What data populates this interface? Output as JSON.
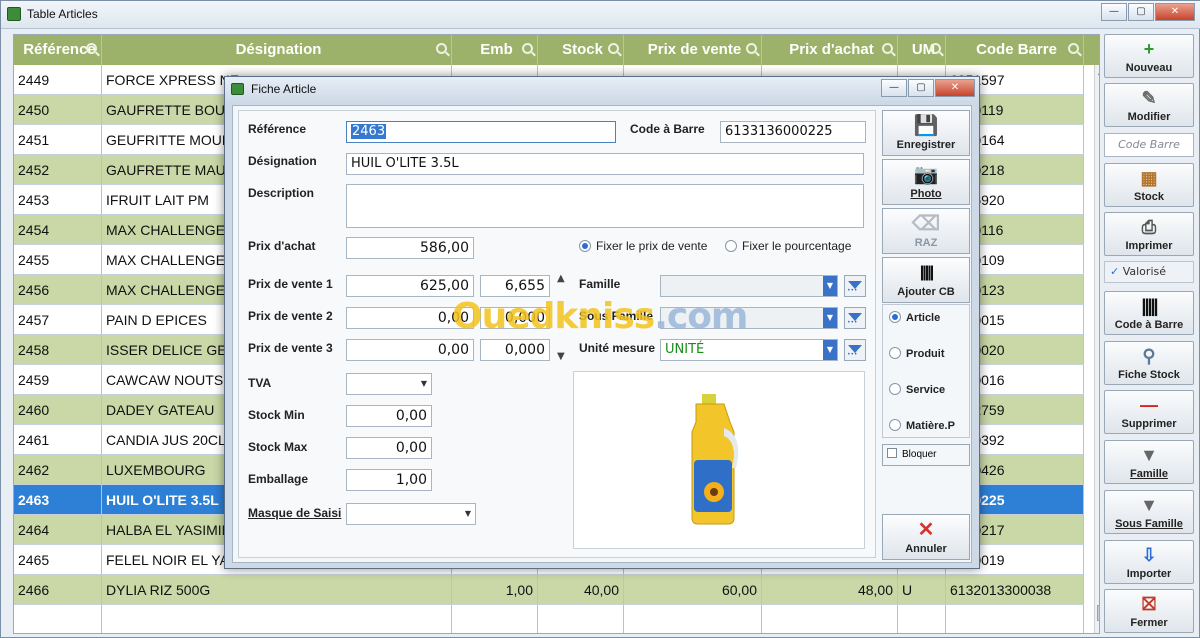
{
  "window": {
    "title": "Table Articles",
    "controls": [
      "—",
      "▢",
      "✕"
    ]
  },
  "grid": {
    "columns": [
      {
        "key": "ref",
        "label": "Référence"
      },
      {
        "key": "des",
        "label": "Désignation"
      },
      {
        "key": "emb",
        "label": "Emb"
      },
      {
        "key": "stock",
        "label": "Stock"
      },
      {
        "key": "pv",
        "label": "Prix de vente"
      },
      {
        "key": "pa",
        "label": "Prix d'achat"
      },
      {
        "key": "um",
        "label": "UM"
      },
      {
        "key": "cb",
        "label": "Code Barre"
      }
    ],
    "rows": [
      {
        "ref": "2449",
        "des": "FORCE XPRESS NE",
        "emb": "",
        "stock": "",
        "pv": "",
        "pa": "",
        "um": "",
        "cb": "6051597"
      },
      {
        "ref": "2450",
        "des": "GAUFRETTE BOUL",
        "emb": "",
        "stock": "",
        "pv": "",
        "pa": "",
        "um": "",
        "cb": "1000119"
      },
      {
        "ref": "2451",
        "des": "GEUFRITTE MOUM",
        "emb": "",
        "stock": "",
        "pv": "",
        "pa": "",
        "um": "",
        "cb": "1000164"
      },
      {
        "ref": "2452",
        "des": "GAUFRETTE MAUM",
        "emb": "",
        "stock": "",
        "pv": "",
        "pa": "",
        "um": "",
        "cb": "1000218"
      },
      {
        "ref": "2453",
        "des": "IFRUIT LAIT PM",
        "emb": "",
        "stock": "",
        "pv": "",
        "pa": "",
        "um": "",
        "cb": "3056920"
      },
      {
        "ref": "2454",
        "des": "MAX CHALLENGE",
        "emb": "",
        "stock": "",
        "pv": "",
        "pa": "",
        "um": "",
        "cb": "2500116"
      },
      {
        "ref": "2455",
        "des": "MAX CHALLENGE",
        "emb": "",
        "stock": "",
        "pv": "",
        "pa": "",
        "um": "",
        "cb": "2500109"
      },
      {
        "ref": "2456",
        "des": "MAX CHALLENGE",
        "emb": "",
        "stock": "",
        "pv": "",
        "pa": "",
        "um": "",
        "cb": "2500123"
      },
      {
        "ref": "2457",
        "des": "PAIN D EPICES",
        "emb": "",
        "stock": "",
        "pv": "",
        "pa": "",
        "um": "",
        "cb": "0000015"
      },
      {
        "ref": "2458",
        "des": "ISSER DELICE GEN",
        "emb": "",
        "stock": "",
        "pv": "",
        "pa": "",
        "um": "",
        "cb": "5000020"
      },
      {
        "ref": "2459",
        "des": "CAWCAW NOUTS",
        "emb": "",
        "stock": "",
        "pv": "",
        "pa": "",
        "um": "",
        "cb": "2370016"
      },
      {
        "ref": "2460",
        "des": "DADEY GATEAU",
        "emb": "",
        "stock": "",
        "pv": "",
        "pa": "",
        "um": "",
        "cb": "1542759"
      },
      {
        "ref": "2461",
        "des": "CANDIA JUS 20CL",
        "emb": "",
        "stock": "",
        "pv": "",
        "pa": "",
        "um": "",
        "cb": "3000392"
      },
      {
        "ref": "2462",
        "des": "LUXEMBOURG",
        "emb": "",
        "stock": "",
        "pv": "",
        "pa": "",
        "um": "",
        "cb": "2000426"
      },
      {
        "ref": "2463",
        "des": "HUIL O'LITE 3.5L",
        "emb": "",
        "stock": "",
        "pv": "",
        "pa": "",
        "um": "",
        "cb": "6000225"
      },
      {
        "ref": "2464",
        "des": "HALBA EL YASIMIN",
        "emb": "",
        "stock": "",
        "pv": "",
        "pa": "",
        "um": "",
        "cb": "3300217"
      },
      {
        "ref": "2465",
        "des": "FELEL NOIR EL YA",
        "emb": "",
        "stock": "",
        "pv": "",
        "pa": "",
        "um": "",
        "cb": "3300019"
      },
      {
        "ref": "2466",
        "des": "DYLIA RIZ 500G",
        "emb": "1,00",
        "stock": "40,00",
        "pv": "60,00",
        "pa": "48,00",
        "um": "U",
        "cb": "6132013300038"
      },
      {
        "ref": "",
        "des": "",
        "emb": "",
        "stock": "",
        "pv": "",
        "pa": "",
        "um": "",
        "cb": ""
      }
    ],
    "selected_index": 14
  },
  "toolbar": {
    "nouveau": "Nouveau",
    "modifier": "Modifier",
    "code_barre_placeholder": "Code Barre",
    "stock": "Stock",
    "imprimer": "Imprimer",
    "valorise": "Valorisé",
    "code_a_barre": "Code à Barre",
    "fiche_stock": "Fiche Stock",
    "supprimer": "Supprimer",
    "famille": "Famille",
    "sous_famille": "Sous Famille",
    "importer": "Importer",
    "fermer": "Fermer"
  },
  "dialog": {
    "title": "Fiche Article",
    "labels": {
      "reference": "Référence",
      "code_a_barre": "Code à Barre",
      "designation": "Désignation",
      "description": "Description",
      "prix_achat": "Prix d'achat",
      "pv1": "Prix de vente 1",
      "pv2": "Prix de vente 2",
      "pv3": "Prix de vente 3",
      "tva": "TVA",
      "stock_min": "Stock Min",
      "stock_max": "Stock Max",
      "emballage": "Emballage",
      "masque": "Masque de Saisi",
      "famille": "Famille",
      "sous_famille": "Sous Famille",
      "unite_mesure": "Unité mesure"
    },
    "values": {
      "reference": "2463",
      "code_a_barre": "6133136000225",
      "designation": "HUIL O'LITE 3.5L",
      "description": "",
      "prix_achat": "586,00",
      "pv1": "625,00",
      "pv1_pct": "6,655",
      "pv2": "0,00",
      "pv2_pct": "0,000",
      "pv3": "0,00",
      "pv3_pct": "0,000",
      "tva": "",
      "stock_min": "0,00",
      "stock_max": "0,00",
      "emballage": "1,00",
      "masque": "",
      "famille": "",
      "sous_famille": "",
      "unite_mesure": "UNITÉ"
    },
    "radios": {
      "fixer_prix": "Fixer le prix de vente",
      "fixer_pct": "Fixer le pourcentage",
      "selected": "fixer_prix"
    },
    "types": {
      "article": "Article",
      "produit": "Produit",
      "service": "Service",
      "matiere": "Matière.P",
      "selected": "article"
    },
    "buttons": {
      "enregistrer": "Enregistrer",
      "photo": "Photo",
      "raz": "RAZ",
      "ajouter_cb": "Ajouter CB",
      "annuler": "Annuler"
    },
    "bloquer": "Bloquer"
  },
  "watermark": {
    "part1": "Ouedkniss",
    "part2": ".com"
  },
  "colors": {
    "header": "#9cb169",
    "alt_row": "#c9d8a6",
    "selected_row": "#2e7fd6",
    "accent": "#3a72c8",
    "cancel": "#d9342b"
  }
}
